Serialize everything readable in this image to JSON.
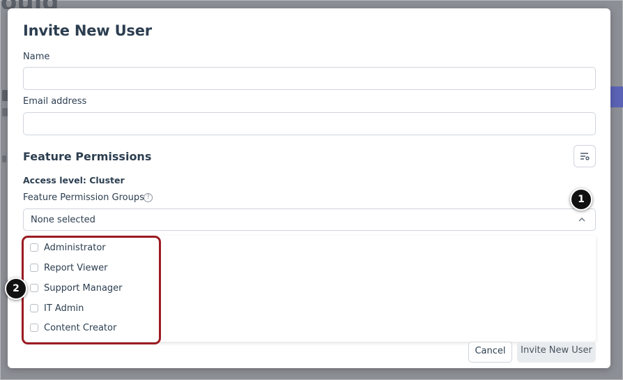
{
  "background": {
    "heading_fragment": "ould"
  },
  "modal": {
    "title": "Invite New User",
    "name_label": "Name",
    "name_value": "",
    "email_label": "Email address",
    "email_value": "",
    "section_title": "Feature Permissions",
    "access_level": "Access level: Cluster",
    "permission_groups_label": "Feature Permission Groups",
    "help_icon_glyph": "?",
    "select_value": "None selected",
    "options": [
      "Administrator",
      "Report Viewer",
      "Support Manager",
      "IT Admin",
      "Content Creator"
    ],
    "cancel_label": "Cancel",
    "invite_label": "Invite New User"
  },
  "callouts": [
    "1",
    "2"
  ],
  "colors": {
    "backdrop": "#8d8f96",
    "title_text": "#2c3e50",
    "highlight": "#9b1b22",
    "accent_purple": "#5a62b5"
  },
  "icons": {
    "filter": "filter-settings-icon",
    "help": "help-circle-icon",
    "chevron": "chevron-up-icon"
  }
}
